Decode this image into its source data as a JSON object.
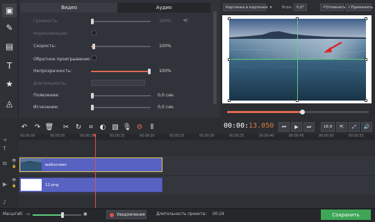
{
  "left_tools": [
    {
      "icon": "film-clip-icon",
      "glyph": "▣"
    },
    {
      "icon": "magic-wand-icon",
      "glyph": "✎"
    },
    {
      "icon": "film-strip-icon",
      "glyph": "▤"
    },
    {
      "icon": "text-icon",
      "glyph": "T"
    },
    {
      "icon": "star-sticker-icon",
      "glyph": "★"
    },
    {
      "icon": "shapes-icon",
      "glyph": "◬"
    },
    {
      "icon": "menu-icon",
      "glyph": "☰"
    }
  ],
  "tabs": {
    "video": "Видео",
    "audio": "Аудио",
    "selected": "video"
  },
  "properties": [
    {
      "label": "Громкость:",
      "value": "100%",
      "fraction": 0.0,
      "type": "slider",
      "disabled": true
    },
    {
      "label": "Нормализация:",
      "type": "checkbox",
      "disabled": true
    },
    {
      "label": "Скорость:",
      "value": "100%",
      "fraction": 0.05,
      "type": "slider",
      "disabled": false
    },
    {
      "label": "Обратное проигрывание:",
      "type": "checkbox",
      "disabled": false
    },
    {
      "label": "Непрозрачность:",
      "value": "100%",
      "fraction": 1.0,
      "type": "slider",
      "disabled": false
    },
    {
      "label": "Длительность:",
      "type": "duration",
      "disabled": true
    },
    {
      "label": "Появление:",
      "value": "0,0 сек.",
      "fraction": 0.0,
      "type": "slider",
      "disabled": false
    },
    {
      "label": "Исчезание:",
      "value": "0,0 сек.",
      "fraction": 0.0,
      "type": "slider",
      "disabled": false
    }
  ],
  "preview_controls": {
    "mode_select": "Картинка в картинке",
    "angle_label": "Угол:",
    "angle_value": "0,0°",
    "cancel": "Отменить",
    "apply": "Применить"
  },
  "playback": {
    "progress": 0.53,
    "timecode_main": "00:00:",
    "timecode_sub": "13.050",
    "aspect": "16:9"
  },
  "ruler_ticks": [
    "00:00:00",
    "00:00:05",
    "00:00:10",
    "00:00:15",
    "00:00:20",
    "00:00:25",
    "00:00:30",
    "00:00:35",
    "00:00:40",
    "00:00:45",
    "00:00:50",
    "00:00:55"
  ],
  "clips": {
    "video": "walkscreen",
    "image": "12.png"
  },
  "status": {
    "scale_label": "Масштаб:",
    "zoom": 0.62,
    "notifications": "Уведомления",
    "duration_label": "Длительность проекта:",
    "duration_value": "00:24",
    "save": "Сохранить"
  },
  "colors": {
    "accent_orange": "#e0694f",
    "guide_green": "#5fd07d",
    "clip_blue": "#5862c1",
    "save_green": "#3ea657"
  }
}
